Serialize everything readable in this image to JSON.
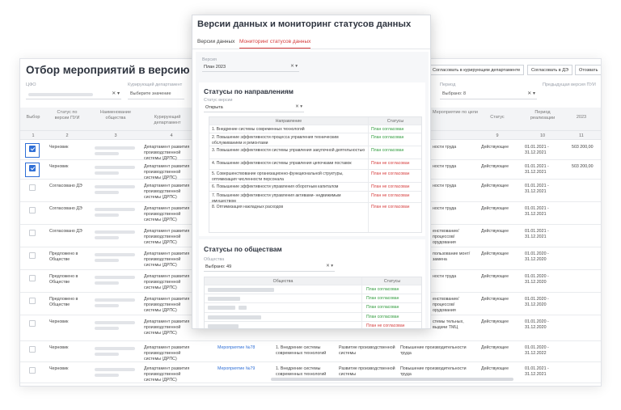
{
  "background": {
    "title": "Отбор мероприятий в версию ПУИ",
    "filters": {
      "cfo_label": "ЦФО",
      "curator_label": "Курирующий департамент",
      "curator_placeholder": "Выберите значение",
      "period_label": "Период",
      "period_value": "Выбрано: 8",
      "prev_version_label": "Предыдущая версия ПУИ",
      "clear_icon": "close-icon",
      "dropdown_icon": "chevron-down-icon"
    },
    "top_buttons": [
      "Согласовать в курирующем департаменте",
      "Согласовать в ДЭ",
      "Отозвать"
    ],
    "columns": [
      "Выбор",
      "Статус по версии ПУИ",
      "Наименование общества",
      "Курирующий департамент",
      "Мероприятие по цели",
      "Статус",
      "Период реализации",
      "2023"
    ],
    "column_numbers": [
      "1",
      "2",
      "3",
      "4",
      "9",
      "10",
      "11"
    ],
    "rows": [
      {
        "checked": true,
        "status": "Черновик",
        "dept": "Департамент развития производственной системы (ДРПС)",
        "measure": "",
        "direction": "",
        "goal": "Повышение производительности труда",
        "goal_short": "ности труда",
        "state": "Действующее",
        "period": "01.01.2021 - 31.12.2021",
        "value": "503 200,00"
      },
      {
        "checked": true,
        "status": "Черновик",
        "dept": "Департамент развития производственной системы (ДРПС)",
        "measure": "",
        "direction": "",
        "goal": "Повышение производительности труда",
        "goal_short": "ности труда",
        "state": "Действующее",
        "period": "01.01.2021 - 31.12.2021",
        "value": "503 200,00"
      },
      {
        "checked": false,
        "status": "Согласовано ДЭ",
        "dept": "Департамент развития производственной системы (ДРПС)",
        "measure": "",
        "direction": "",
        "goal": "",
        "goal_short": "ности труда",
        "state": "Действующее",
        "period": "01.01.2021 - 31.12.2021",
        "value": ""
      },
      {
        "checked": false,
        "status": "Согласовано ДЭ",
        "dept": "Департамент развития производственной системы (ДРПС)",
        "measure": "",
        "direction": "",
        "goal": "",
        "goal_short": "ности труда",
        "state": "Действующее",
        "period": "01.01.2021 - 31.12.2021",
        "value": ""
      },
      {
        "checked": false,
        "status": "Согласовано ДЭ",
        "dept": "Департамент развития производственной системы (ДРПС)",
        "measure": "",
        "direction": "",
        "goal": "",
        "goal_short": "енствование/ процессов/ орудования",
        "state": "Действующее",
        "period": "01.01.2021 - 31.12.2021",
        "value": ""
      },
      {
        "checked": false,
        "status": "Предложено в Обществе",
        "dept": "Департамент развития производственной системы (ДРПС)",
        "measure": "",
        "direction": "",
        "goal": "",
        "goal_short": "пользование монт/замена",
        "state": "Действующее",
        "period": "01.01.2020 - 31.12.2020",
        "value": ""
      },
      {
        "checked": false,
        "status": "Предложено в Обществе",
        "dept": "Департамент развития производственной системы (ДРПС)",
        "measure": "",
        "direction": "",
        "goal": "",
        "goal_short": "ности труда",
        "state": "Действующее",
        "period": "01.01.2020 - 31.12.2020",
        "value": ""
      },
      {
        "checked": false,
        "status": "Предложено в Обществе",
        "dept": "Департамент развития производственной системы (ДРПС)",
        "measure": "",
        "direction": "",
        "goal": "",
        "goal_short": "енствование/ процессов/ орудования",
        "state": "Действующее",
        "period": "01.01.2020 - 31.12.2020",
        "value": ""
      },
      {
        "checked": false,
        "status": "Черновик",
        "dept": "Департамент развития производственной системы (ДРПС)",
        "measure": "",
        "direction": "",
        "goal": "",
        "goal_short": "стемы тельных, выдачи ТМЦ",
        "state": "Действующее",
        "period": "01.01.2020 - 31.12.2020",
        "value": ""
      },
      {
        "checked": false,
        "status": "Черновик",
        "dept": "Департамент развития производственной системы (ДРПС)",
        "measure": "Мероприятие №78",
        "direction": "1. Внедрение системы современных технологий",
        "goal": "Развитие производственной системы",
        "goal_short": "Повышение производительности труда",
        "state": "Действующее",
        "period": "01.01.2020 - 31.12.2022",
        "value": ""
      },
      {
        "checked": false,
        "status": "Черновик",
        "dept": "Департамент развития производственной системы (ДРПС)",
        "measure": "Мероприятие №79",
        "direction": "1. Внедрение системы современных технологий",
        "goal": "Развитие производственной системы",
        "goal_short": "Повышение производительности труда",
        "state": "Действующее",
        "period": "01.01.2021 - 31.12.2021",
        "value": ""
      }
    ]
  },
  "modal": {
    "title": "Версии данных и мониторинг статусов данных",
    "tabs": [
      "Версии данных",
      "Мониторинг статусов данных"
    ],
    "version_label": "Версия",
    "version_value": "План 2023",
    "directions_panel": {
      "title": "Статусы по направлениям",
      "status_version_label": "Статус версии",
      "status_version_value": "Открыта",
      "col_direction": "Направление",
      "col_status": "Статусы",
      "rows": [
        {
          "name": "1. Внедрение системы современных технологий",
          "status": "План согласован",
          "ok": true
        },
        {
          "name": "2. Повышение эффективности процесса управления техническим обслуживанием и ремонтами",
          "status": "План согласован",
          "ok": true
        },
        {
          "name": "3. Повышение эффективности системы управления закупочной деятельностью",
          "status": "План согласован",
          "ok": true
        },
        {
          "name": "4. Повышение эффективности системы управления цепочками поставок",
          "status": "План не согласован",
          "ok": false
        },
        {
          "name": "5. Совершенствование организационно-функциональной структуры, оптимизация численности персонала",
          "status": "План не согласован",
          "ok": false
        },
        {
          "name": "6. Повышение эффективности управления оборотным капиталом",
          "status": "План не согласован",
          "ok": false
        },
        {
          "name": "7. Повышение эффективности управления активами- недвижимым имуществом",
          "status": "План не согласован",
          "ok": false
        },
        {
          "name": "8. Оптимизация накладных расходов",
          "status": "План не согласован",
          "ok": false
        }
      ]
    },
    "companies_panel": {
      "title": "Статусы по обществам",
      "companies_label": "Общества",
      "companies_value": "Выбрано: 49",
      "col_company": "Общества",
      "col_status": "Статусы",
      "rows": [
        {
          "status": "План согласован",
          "ok": true
        },
        {
          "status": "План согласован",
          "ok": true
        },
        {
          "status": "План согласован",
          "ok": true
        },
        {
          "status": "План согласован",
          "ok": true
        },
        {
          "status": "План не согласован",
          "ok": false
        }
      ]
    },
    "colors": {
      "accent": "#d53a3a",
      "ok": "#2e9a3b",
      "link": "#2f6fd6"
    }
  }
}
